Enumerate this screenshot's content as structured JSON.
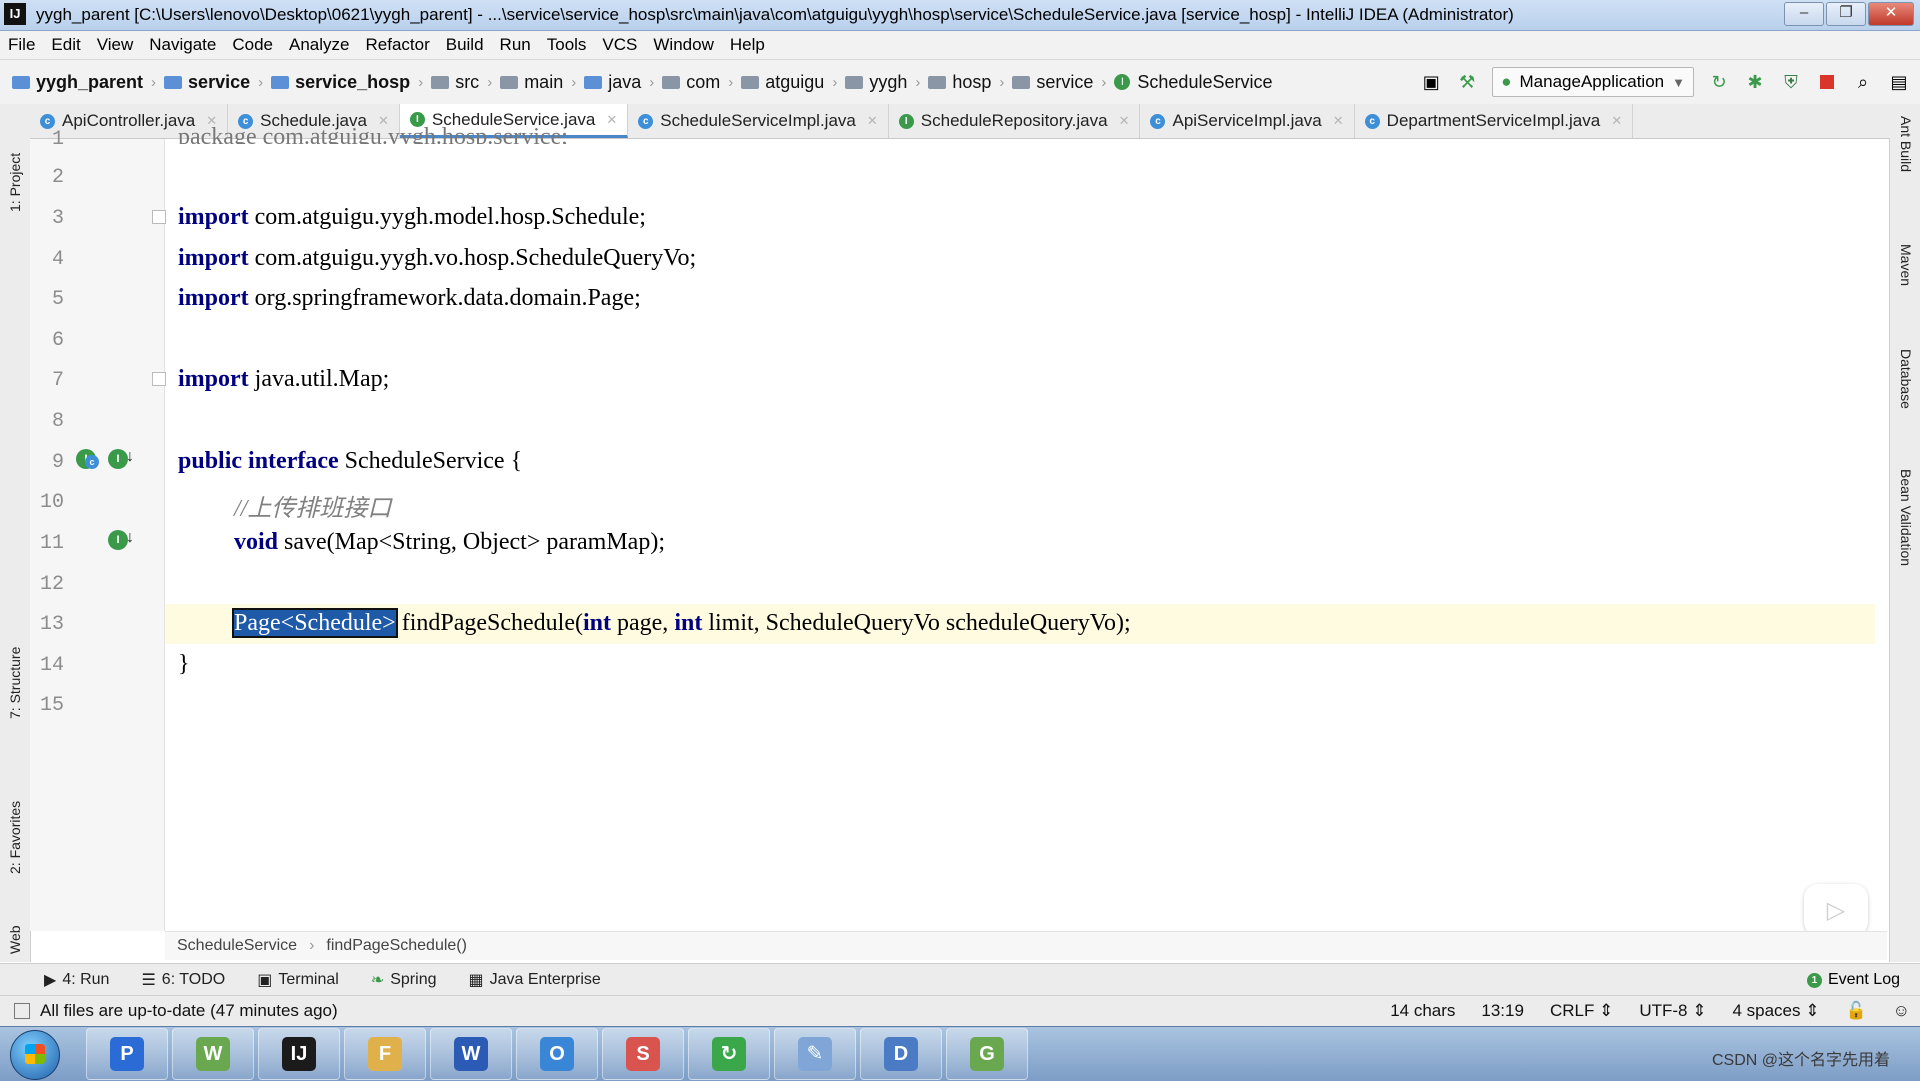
{
  "window": {
    "title": "yygh_parent [C:\\Users\\lenovo\\Desktop\\0621\\yygh_parent] - ...\\service\\service_hosp\\src\\main\\java\\com\\atguigu\\yygh\\hosp\\service\\ScheduleService.java [service_hosp] - IntelliJ IDEA (Administrator)",
    "app_icon": "IJ"
  },
  "menu": [
    "File",
    "Edit",
    "View",
    "Navigate",
    "Code",
    "Analyze",
    "Refactor",
    "Build",
    "Run",
    "Tools",
    "VCS",
    "Window",
    "Help"
  ],
  "nav": {
    "crumbs": [
      "yygh_parent",
      "service",
      "service_hosp",
      "src",
      "main",
      "java",
      "com",
      "atguigu",
      "yygh",
      "hosp",
      "service",
      "ScheduleService"
    ],
    "run_config": "ManageApplication"
  },
  "tabs": [
    {
      "label": "ApiController.java",
      "kind": "C"
    },
    {
      "label": "Schedule.java",
      "kind": "C"
    },
    {
      "label": "ScheduleService.java",
      "kind": "I",
      "active": true
    },
    {
      "label": "ScheduleServiceImpl.java",
      "kind": "C"
    },
    {
      "label": "ScheduleRepository.java",
      "kind": "I"
    },
    {
      "label": "ApiServiceImpl.java",
      "kind": "C"
    },
    {
      "label": "DepartmentServiceImpl.java",
      "kind": "C"
    }
  ],
  "left_tools": [
    "1: Project",
    "7: Structure",
    "2: Favorites",
    "Web"
  ],
  "right_tools": [
    "Ant Build",
    "Maven",
    "Database",
    "Bean Validation"
  ],
  "code": {
    "line_numbers": [
      "1",
      "2",
      "3",
      "4",
      "5",
      "6",
      "7",
      "8",
      "9",
      "10",
      "11",
      "12",
      "13",
      "14",
      "15"
    ],
    "line1": "package com.atguigu.yygh.hosp.service;",
    "import1": "com.atguigu.yygh.model.hosp.Schedule;",
    "import2": "com.atguigu.yygh.vo.hosp.ScheduleQueryVo;",
    "import3": "org.springframework.data.domain.Page;",
    "import4": "java.util.Map;",
    "kw_import": "import",
    "kw_public": "public",
    "kw_interface": "interface",
    "iface_name": "ScheduleService {",
    "comment": "//上传排班接口",
    "kw_void": "void",
    "save_sig": "save(Map<String, Object> paramMap);",
    "selected_type": "Page<Schedule>",
    "method13_a": "findPageSchedule(",
    "kw_int": "int",
    "method13_b": "page,",
    "method13_c": "limit,",
    "method13_d": "ScheduleQueryVo scheduleQueryVo);",
    "close_brace": "}"
  },
  "editor_breadcrumb": [
    "ScheduleService",
    "findPageSchedule()"
  ],
  "bottom_tools": [
    "4: Run",
    "6: TODO",
    "Terminal",
    "Spring",
    "Java Enterprise"
  ],
  "event_log": "Event Log",
  "status": {
    "message": "All files are up-to-date (47 minutes ago)",
    "chars": "14 chars",
    "position": "13:19",
    "line_sep": "CRLF ⇕",
    "encoding": "UTF-8 ⇕",
    "indent": "4 spaces ⇕"
  },
  "taskbar": {
    "apps": [
      {
        "name": "P",
        "color": "#2a6bd6"
      },
      {
        "name": "W",
        "color": "#6aa84f"
      },
      {
        "name": "IJ",
        "color": "#1b1b1b"
      },
      {
        "name": "F",
        "color": "#e0b14a"
      },
      {
        "name": "W",
        "color": "#2b5bb5"
      },
      {
        "name": "O",
        "color": "#3a86d6"
      },
      {
        "name": "S",
        "color": "#d9534f"
      },
      {
        "name": "↻",
        "color": "#3aa84a"
      },
      {
        "name": "✎",
        "color": "#7fa6d6"
      },
      {
        "name": "D",
        "color": "#4a7bc4"
      },
      {
        "name": "G",
        "color": "#6aa84f"
      }
    ],
    "watermark": "CSDN @这个名字先用着"
  }
}
